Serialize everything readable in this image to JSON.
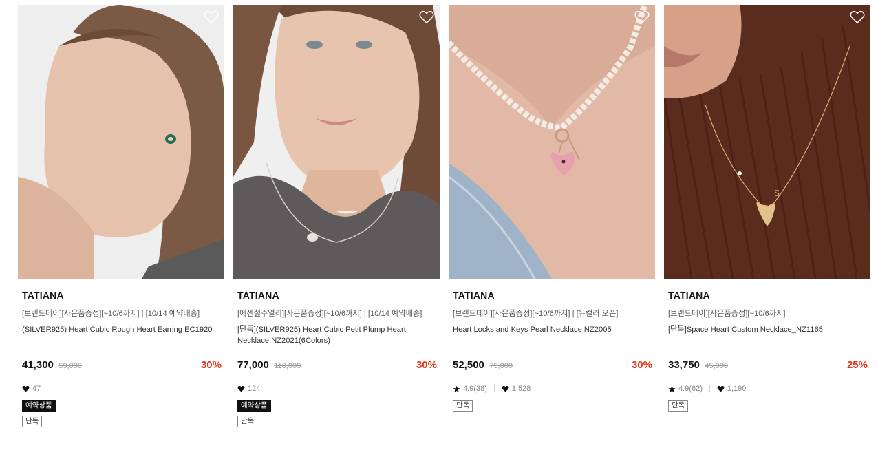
{
  "products": [
    {
      "brand": "TATIANA",
      "promo": "[브랜드데이][사은품증정][~10/6까지] | [10/14 예약배송]",
      "name": "(SILVER925) Heart Cubic Rough Heart Earring EC1920",
      "price": "41,300",
      "original_price": "59,000",
      "discount": "30%",
      "rating": "",
      "likes": "47",
      "badges": [
        "예약상품",
        "단독"
      ]
    },
    {
      "brand": "TATIANA",
      "promo": "[에센셜주얼리][사은품증정][~10/6까지] | [10/14 예약배송]",
      "name": "[단독](SILVER925) Heart Cubic Petit Plump Heart Necklace NZ2021(6Colors)",
      "price": "77,000",
      "original_price": "110,000",
      "discount": "30%",
      "rating": "",
      "likes": "124",
      "badges": [
        "예약상품",
        "단독"
      ]
    },
    {
      "brand": "TATIANA",
      "promo": "[브랜드데이][사은품증정][~10/6까지] | [뉴컬러 오픈]",
      "name": "Heart Locks and Keys Pearl Necklace NZ2005",
      "price": "52,500",
      "original_price": "75,000",
      "discount": "30%",
      "rating": "4.9(38)",
      "likes": "1,528",
      "badges": [
        "단독"
      ]
    },
    {
      "brand": "TATIANA",
      "promo": "[브랜드데이][사은품증정][~10/6까지]",
      "name": "[단독]Space Heart Custom Necklace_NZ1165",
      "price": "33,750",
      "original_price": "45,000",
      "discount": "25%",
      "rating": "4.9(62)",
      "likes": "1,190",
      "badges": [
        "단독"
      ]
    }
  ],
  "icons": {
    "wishlist": "heart-outline-icon",
    "likes": "heart-filled-icon",
    "rating": "star-icon"
  },
  "colors": {
    "discount": "#e5391c",
    "badge_black": "#111111",
    "strike_price": "#999999"
  }
}
